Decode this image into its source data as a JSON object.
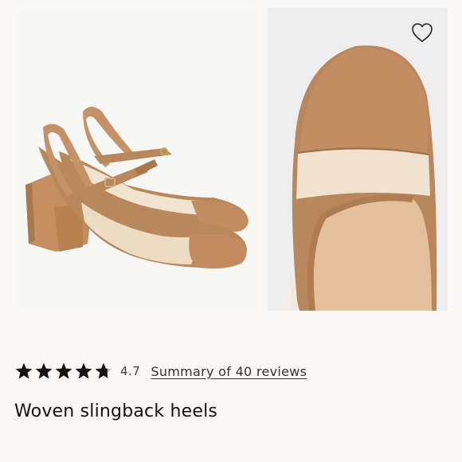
{
  "gallery": {
    "images": [
      {
        "name": "slingback-heels-side-view"
      },
      {
        "name": "slingback-heels-toe-detail"
      }
    ],
    "wishlist_icon": "heart-outline-icon"
  },
  "rating": {
    "stars_filled": 4.7,
    "stars_total": 5,
    "value": "4.7",
    "reviews_link": "Summary of 40 reviews"
  },
  "product": {
    "title": "Woven slingback heels"
  },
  "colors": {
    "background": "#fbf8f5",
    "suede": "#b9875c",
    "canvas": "#eee0cb",
    "text": "#111111"
  }
}
